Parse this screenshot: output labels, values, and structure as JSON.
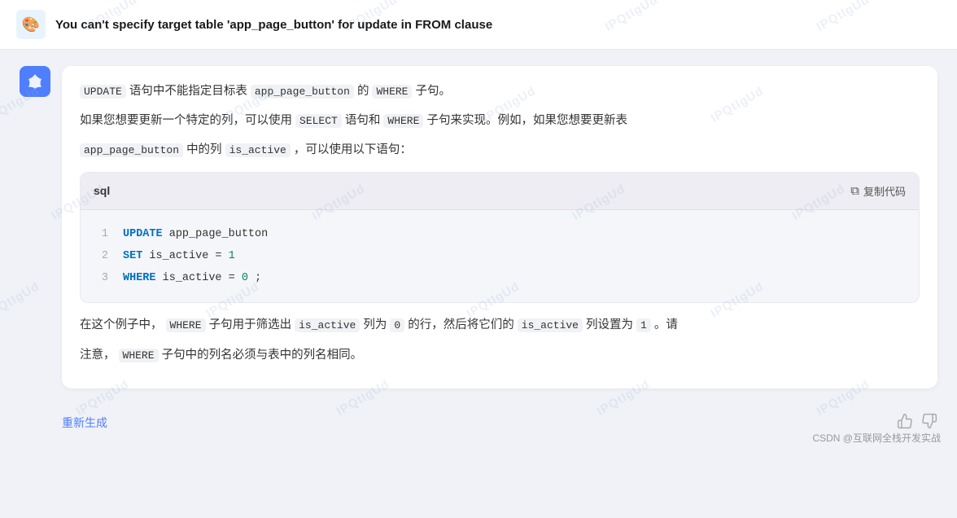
{
  "header": {
    "logo_emoji": "🎨",
    "title": "You can't specify target table 'app_page_button' for update in FROM clause"
  },
  "avatar": {
    "icon": "✦"
  },
  "message": {
    "line1_prefix": "UPDATE",
    "line1_middle": " 语句中不能指定目标表 ",
    "line1_code": "app_page_button",
    "line1_suffix": " 的 ",
    "line1_code2": "WHERE",
    "line1_end": " 子句。",
    "line2": "如果您想要更新一个特定的列，可以使用 SELECT 语句和 WHERE 子句来实现。例如，如果您想要更新表",
    "line2_select": "SELECT",
    "line2_where": "WHERE",
    "line3_code1": "app_page_button",
    "line3_middle": " 中的列 ",
    "line3_code2": "is_active",
    "line3_end": " ，可以使用以下语句：",
    "line5_prefix": "在这个例子中，",
    "line5_code1": "WHERE",
    "line5_text1": " 子句用于筛选出 ",
    "line5_code2": "is_active",
    "line5_text2": " 列为 ",
    "line5_code3": "0",
    "line5_text3": " 的行，然后将它们的 ",
    "line5_code4": "is_active",
    "line5_text4": " 列设置为 ",
    "line5_code5": "1",
    "line5_text5": " 。请",
    "line6_text": "注意，",
    "line6_code": "WHERE",
    "line6_suffix": " 子句中的列名必须与表中的列名相同。"
  },
  "code_block": {
    "lang": "sql",
    "copy_label": "复制代码",
    "lines": [
      {
        "num": "1",
        "content": "UPDATE app_page_button"
      },
      {
        "num": "2",
        "content": "SET is_active = 1"
      },
      {
        "num": "3",
        "content": "WHERE is_active = 0;"
      }
    ]
  },
  "actions": {
    "regenerate": "重新生成"
  },
  "footer": {
    "credit": "CSDN @互联网全栈开发实战"
  },
  "watermark_text": "IPQtIgUd"
}
